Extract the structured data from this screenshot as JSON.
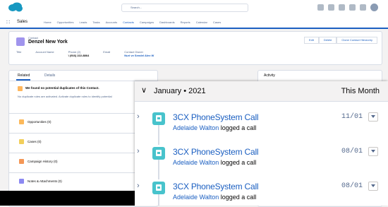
{
  "global_header": {
    "search_placeholder": "Search..."
  },
  "nav": {
    "app_name": "Sales",
    "items": [
      "Home",
      "Opportunities",
      "Leads",
      "Tasks",
      "Accounts",
      "Contacts",
      "Campaigns",
      "Dashboards",
      "Reports",
      "Calendar",
      "Cases"
    ],
    "active_item": "Contacts"
  },
  "record": {
    "object_type": "Contact",
    "name": "Denzel New York",
    "buttons": [
      "Edit",
      "Delete",
      "Clone Contact Hierarchy"
    ],
    "fields": [
      {
        "label": "Title",
        "value": ""
      },
      {
        "label": "Account Name",
        "value": ""
      },
      {
        "label": "Phone (2)",
        "value": "\\ (916) 222-8864"
      },
      {
        "label": "Email",
        "value": ""
      },
      {
        "label": "Contact Owner",
        "value": "Nuri ve Sendel Alex W"
      }
    ]
  },
  "left_panel": {
    "tabs": [
      "Related",
      "Details"
    ],
    "duplicates_title": "We found no potential duplicates of this Contact.",
    "duplicates_text": "No duplicate rules are activated. Activate duplicate rules to identify potential",
    "related_lists": [
      {
        "label": "Opportunities (0)",
        "color": "#fcb95b"
      },
      {
        "label": "Cases (0)",
        "color": "#f2cf5b"
      },
      {
        "label": "Campaign History (0)",
        "color": "#f49756"
      },
      {
        "label": "Notes & Attachments (0)",
        "color": "#8c89f2"
      }
    ]
  },
  "activity_panel": {
    "tab": "Activity"
  },
  "timeline": {
    "month": "January • 2021",
    "right_label": "This Month",
    "activities": [
      {
        "subject": "3CX PhoneSystem Call",
        "person": "Adelaide Walton",
        "verb": "logged a call",
        "date": "11/01"
      },
      {
        "subject": "3CX PhoneSystem Call",
        "person": "Adelaide Walton",
        "verb": "logged a call",
        "date": "08/01"
      },
      {
        "subject": "3CX PhoneSystem Call",
        "person": "Adelaide Walton",
        "verb": "logged a call",
        "date": "08/01"
      }
    ]
  },
  "colors": {
    "brand": "#1b5fc1",
    "call_icon": "#48c3cc",
    "contact_icon": "#a094ed"
  }
}
